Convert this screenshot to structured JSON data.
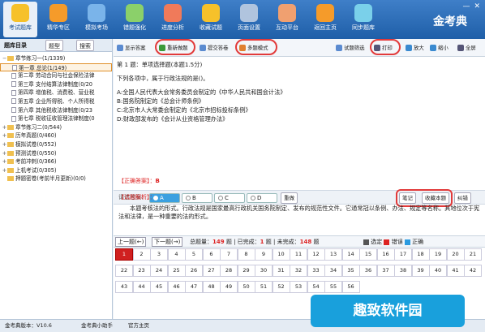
{
  "nav": [
    {
      "label": "考试题库",
      "icon": "book-icon",
      "active": true
    },
    {
      "label": "精华专区",
      "icon": "play-icon"
    },
    {
      "label": "模拟考场",
      "icon": "monitor-icon"
    },
    {
      "label": "错题强化",
      "icon": "stack-icon"
    },
    {
      "label": "进度分析",
      "icon": "chart-icon"
    },
    {
      "label": "收藏试题",
      "icon": "star-icon"
    },
    {
      "label": "页面设置",
      "icon": "gear-icon"
    },
    {
      "label": "互动平台",
      "icon": "people-icon"
    },
    {
      "label": "返回主页",
      "icon": "home-icon"
    },
    {
      "label": "同步题库",
      "icon": "cloud-sync-icon"
    }
  ],
  "logo": "金考典",
  "left": {
    "tab_catalog": "题库目录",
    "tab_type": "题型",
    "tab_search": "搜索",
    "tree": [
      {
        "label": "章节练习一(1/1339)",
        "level": 0,
        "toggle": "−"
      },
      {
        "label": "第一章 总论(1/149)",
        "level": 1,
        "selected": true
      },
      {
        "label": "第二章 劳动合同与社会保险法律",
        "level": 1
      },
      {
        "label": "第三章 支付结算法律制度(0/20",
        "level": 1
      },
      {
        "label": "第四章 增值税、消费税、营业税",
        "level": 1
      },
      {
        "label": "第五章 企业所得税、个人所得税",
        "level": 1
      },
      {
        "label": "第六章 其他税收法律制度(0/23",
        "level": 1
      },
      {
        "label": "第七章 税收征收管理法律制度(0",
        "level": 1
      },
      {
        "label": "章节练习二(0/544)",
        "level": 0,
        "toggle": "+"
      },
      {
        "label": "历年真题(0/460)",
        "level": 0,
        "toggle": "+"
      },
      {
        "label": "模拟试卷(0/552)",
        "level": 0,
        "toggle": "+"
      },
      {
        "label": "预测试卷(0/550)",
        "level": 0,
        "toggle": "+"
      },
      {
        "label": "考前冲刺(0/366)",
        "level": 0,
        "toggle": "+"
      },
      {
        "label": "上机考试(0/305)",
        "level": 0,
        "toggle": "+"
      },
      {
        "label": "押题密卷(考前半月更新)(0/0)",
        "level": 0,
        "toggle": ""
      }
    ]
  },
  "toolbar": {
    "show_answer": "显示答案",
    "reset": "重新做题",
    "submit": "提交答卷",
    "multi": "多题模式",
    "filter": "试题筛选",
    "print": "打印",
    "zoom_in": "放大",
    "zoom_out": "缩小",
    "fullscreen": "全屏"
  },
  "question": {
    "header": "第 1 题：单项选择题(本题1.5分)",
    "stem": "下列各项中，属于行政法规的是()。",
    "options": [
      "A:全国人民代表大会常务委员会制定的《中华人民共和国会计法》",
      "B:国务院制定的《总会计师条例》",
      "C:北京市人大常委会制定的《北京市招标投标条例》",
      "D:财政部发布的《会计从业资格管理办法》"
    ]
  },
  "answer_bar": {
    "label": "请选答案:",
    "choices": [
      "A",
      "B",
      "C",
      "D"
    ],
    "selected": "A",
    "redo": "重做",
    "note": "笔记",
    "collect": "收藏本题",
    "correct": "纠错"
  },
  "explain": {
    "correct_label": "【正确答案】：",
    "correct_value": "B",
    "analysis_label": "【试题解析】：",
    "analysis_text": "本题考核法的形式。行政法规是国家最高行政机关国务院制定、发布的规范性文件。它通常冠以条例、办法、规定等名称。其地位次于宪法和法律，是一种重要的法的形式。"
  },
  "progress": {
    "prev": "上一题(←)",
    "next": "下一题(→)",
    "total_label": "总题量：",
    "total": "149",
    "unit": "题",
    "done_label": "已完成：",
    "done": "1",
    "undone_label": "未完成：",
    "undone": "148",
    "legend_done": "选定",
    "legend_wrong": "错误",
    "legend_right": "正确"
  },
  "grid_numbers": [
    "1",
    "2",
    "3",
    "4",
    "5",
    "6",
    "7",
    "8",
    "9",
    "10",
    "11",
    "12",
    "13",
    "14",
    "15",
    "16",
    "17",
    "18",
    "19",
    "20",
    "21",
    "22",
    "23",
    "24",
    "25",
    "26",
    "27",
    "28",
    "29",
    "30",
    "31",
    "32",
    "33",
    "34",
    "35",
    "36",
    "37",
    "38",
    "39",
    "40",
    "41",
    "42",
    "43",
    "44",
    "45",
    "46",
    "47",
    "48",
    "49",
    "50",
    "51",
    "52",
    "53",
    "54",
    "55",
    "56"
  ],
  "status": {
    "version": "金考典版本：V10.6",
    "assistant": "金考典小助手",
    "home": "官方主页"
  },
  "watermark": "趣致软件园",
  "colors": {
    "nav_bg": "#2a6cb8",
    "accent": "#e23a3a",
    "selected": "#3aa0e0"
  }
}
